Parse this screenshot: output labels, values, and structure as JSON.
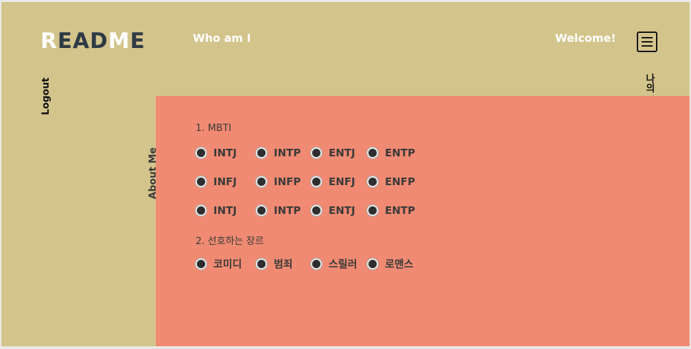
{
  "header": {
    "logo_first": "R",
    "logo_mid": "EAD",
    "logo_m": "M",
    "logo_last": "E",
    "nav_left": "Who am I",
    "nav_right": "Welcome!"
  },
  "sidebar": {
    "logout": "Logout",
    "about_me": "About Me",
    "my_personality": "나의 성향"
  },
  "form": {
    "q1_label": "1. MBTI",
    "mbti_rows": [
      [
        "INTJ",
        "INTP",
        "ENTJ",
        "ENTP"
      ],
      [
        "INFJ",
        "INFP",
        "ENFJ",
        "ENFP"
      ],
      [
        "INTJ",
        "INTP",
        "ENTJ",
        "ENTP"
      ]
    ],
    "q2_label": "2. 선호하는 장르",
    "genres": [
      "코미디",
      "범죄",
      "스릴러",
      "로맨스"
    ]
  },
  "colors": {
    "background": "#d3c48b",
    "panel": "#f08a72",
    "logo_dark": "#2f3a45"
  },
  "icons": {
    "menu": "hamburger-menu-icon"
  }
}
